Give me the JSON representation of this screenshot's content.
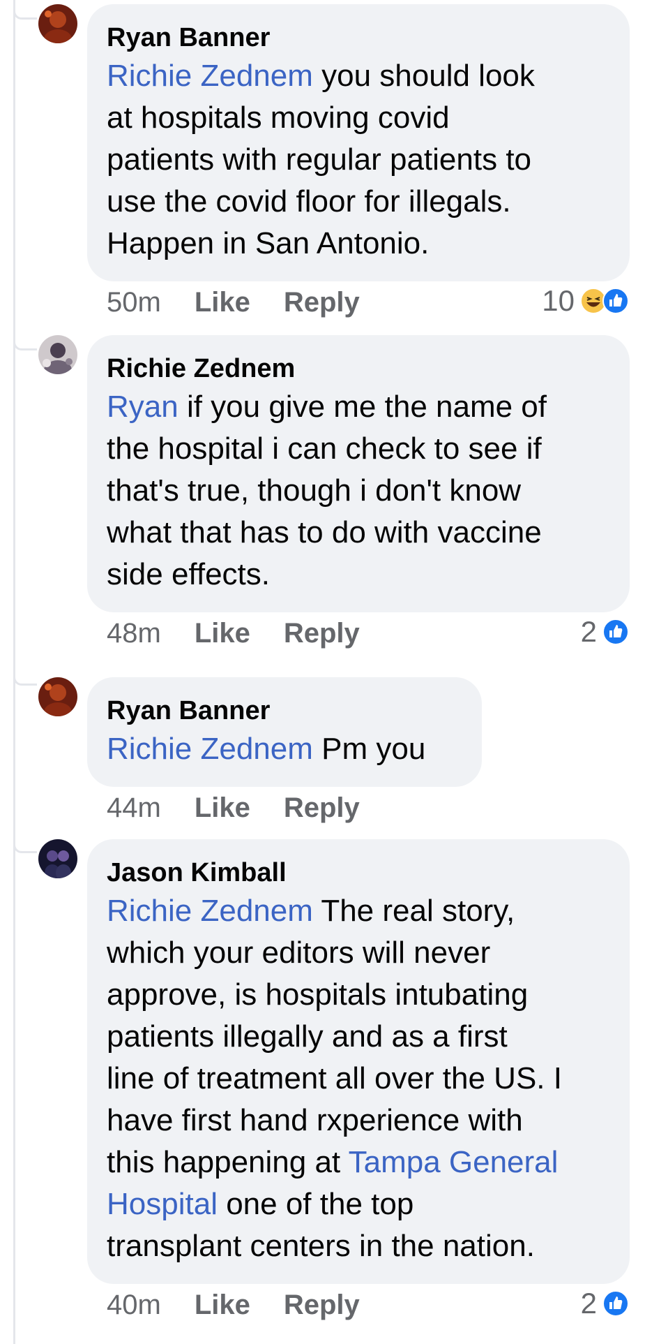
{
  "colors": {
    "mention": "#3b64c4",
    "bubble": "#f0f2f5",
    "meta": "#65676b",
    "like_blue": "#1877f2",
    "haha_yellow": "#f7c34a"
  },
  "comments": [
    {
      "author": "Ryan Banner",
      "mention": "Richie Zednem",
      "text": " you should look\nat hospitals moving covid\npatients with regular patients to\nuse the covid floor for illegals.\nHappen in San Antonio.",
      "time": "50m",
      "like_label": "Like",
      "reply_label": "Reply",
      "reaction_count": "10",
      "reaction_icons": [
        "haha-icon",
        "like-icon"
      ]
    },
    {
      "author": "Richie Zednem",
      "mention": "Ryan",
      "text": " if you give me the name of\nthe hospital i can check to see if\nthat's true, though i don't know\nwhat that has to do with vaccine\nside effects.",
      "time": "48m",
      "like_label": "Like",
      "reply_label": "Reply",
      "reaction_count": "2",
      "reaction_icons": [
        "like-icon"
      ]
    },
    {
      "author": "Ryan Banner",
      "mention": "Richie Zednem",
      "text": " Pm you",
      "time": "44m",
      "like_label": "Like",
      "reply_label": "Reply"
    },
    {
      "author": "Jason Kimball",
      "mention": "Richie Zednem",
      "text_part1": " The real story,\nwhich your editors will never\napprove, is hospitals intubating\npatients illegally and as a first\nline of treatment all over the US. I\nhave first hand rxperience with\nthis happening at ",
      "mention2": "Tampa General\nHospital",
      "text_part2": " one of the top\ntransplant centers in the nation.",
      "time": "40m",
      "like_label": "Like",
      "reply_label": "Reply",
      "reaction_count": "2",
      "reaction_icons": [
        "like-icon"
      ]
    }
  ]
}
